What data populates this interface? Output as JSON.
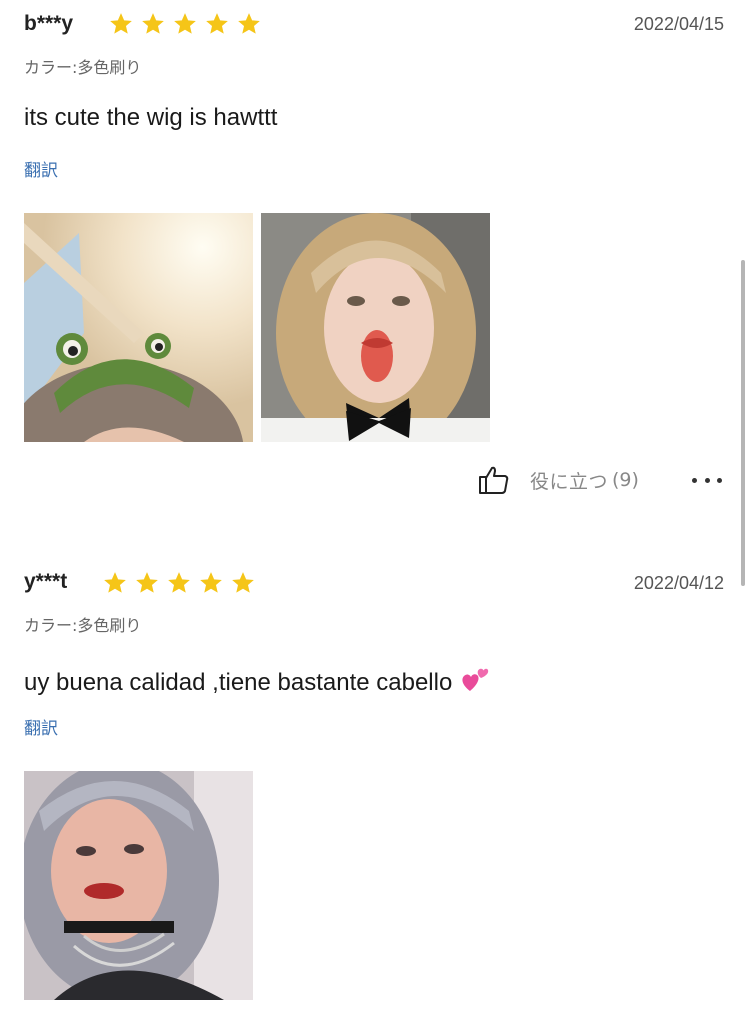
{
  "reviews": [
    {
      "username": "b***y",
      "rating": 5,
      "date": "2022/04/15",
      "variant": "カラー:多色刷り",
      "comment": "its cute the wig is hawttt",
      "translate": "翻訳",
      "photos": [
        "frog-hat-selfie-photo",
        "blonde-wig-selfie-photo"
      ],
      "helpful_label": "役に立つ",
      "helpful_count": "(9)"
    },
    {
      "username": "y***t",
      "rating": 5,
      "date": "2022/04/12",
      "variant": "カラー:多色刷り",
      "comment": "uy buena calidad  ,tiene bastante cabello",
      "comment_emoji": "two-hearts-icon",
      "translate": "翻訳",
      "photos": [
        "silver-wig-selfie-photo"
      ]
    }
  ],
  "colors": {
    "star": "#f5c518",
    "link": "#3a6fb0",
    "muted": "#888888"
  },
  "icons": [
    "star-icon",
    "thumbs-up-icon",
    "more-icon",
    "two-hearts-icon"
  ]
}
